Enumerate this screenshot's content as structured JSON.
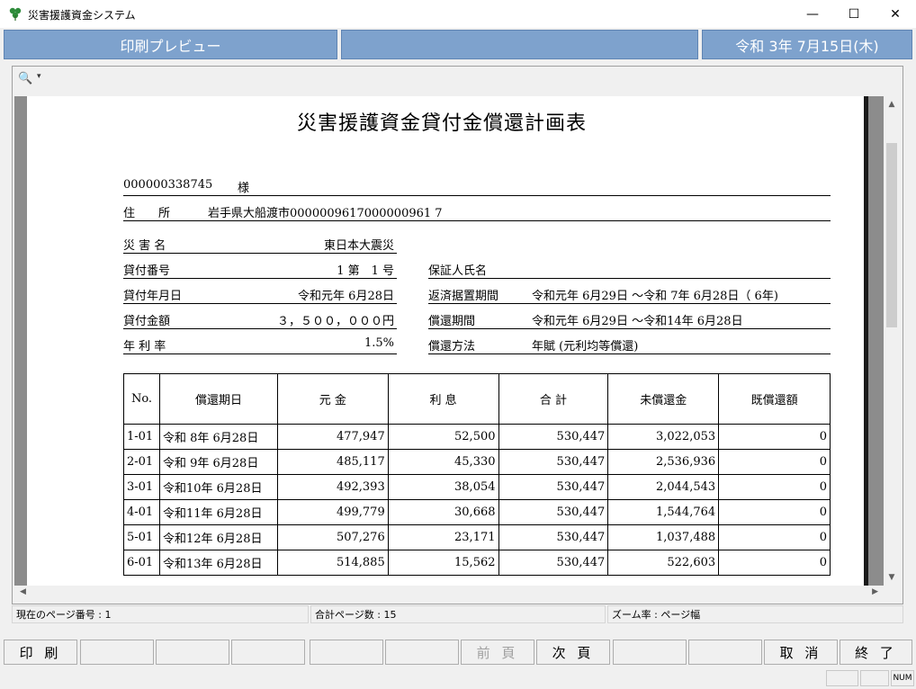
{
  "window": {
    "title": "災害援護資金システム",
    "minimize": "—",
    "maximize": "☐",
    "close": "✕"
  },
  "header": {
    "screen_name": "印刷プレビュー",
    "middle": "",
    "date": "令和 3年 7月15日(木)"
  },
  "report": {
    "title": "災害援護資金貸付金償還計画表",
    "borrower_id": "000000338745",
    "honorific": "様",
    "address_label": "住　　所",
    "address_value": "岩手県大船渡市0000009617000000961 7",
    "disaster_label": "災 害 名",
    "disaster_value": "東日本大震災",
    "loan_no_label": "貸付番号",
    "loan_no_value": "1 第　1 号",
    "loan_date_label": "貸付年月日",
    "loan_date_value": "令和元年 6月28日",
    "amount_label": "貸付金額",
    "amount_value": "３，５００，０００円",
    "rate_label": "年 利 率",
    "rate_value": "1.5%",
    "guarantor_label": "保証人氏名",
    "guarantor_value": "",
    "deferral_label": "返済据置期間",
    "deferral_value": "令和元年 6月29日 ～令和 7年 6月28日（ 6年)",
    "repay_period_label": "償還期間",
    "repay_period_value": "令和元年 6月29日 ～令和14年 6月28日",
    "repay_method_label": "償還方法",
    "repay_method_value": "年賦 (元利均等償還)",
    "columns": [
      "No.",
      "償還期日",
      "元 金",
      "利 息",
      "合 計",
      "未償還金",
      "既償還額"
    ],
    "rows": [
      [
        "1-01",
        "令和 8年 6月28日",
        "477,947",
        "52,500",
        "530,447",
        "3,022,053",
        "0"
      ],
      [
        "2-01",
        "令和 9年 6月28日",
        "485,117",
        "45,330",
        "530,447",
        "2,536,936",
        "0"
      ],
      [
        "3-01",
        "令和10年 6月28日",
        "492,393",
        "38,054",
        "530,447",
        "2,044,543",
        "0"
      ],
      [
        "4-01",
        "令和11年 6月28日",
        "499,779",
        "30,668",
        "530,447",
        "1,544,764",
        "0"
      ],
      [
        "5-01",
        "令和12年 6月28日",
        "507,276",
        "23,171",
        "530,447",
        "1,037,488",
        "0"
      ],
      [
        "6-01",
        "令和13年 6月28日",
        "514,885",
        "15,562",
        "530,447",
        "522,603",
        "0"
      ]
    ]
  },
  "status": {
    "current_page": "現在のページ番号 : 1",
    "total_pages": "合計ページ数 : 15",
    "zoom": "ズーム率 : ページ幅"
  },
  "fkeys": [
    "印 刷",
    "",
    "",
    "",
    "",
    "",
    "前 頁",
    "次 頁",
    "",
    "",
    "取 消",
    "終 了"
  ],
  "bottom": {
    "num": "NUM"
  }
}
